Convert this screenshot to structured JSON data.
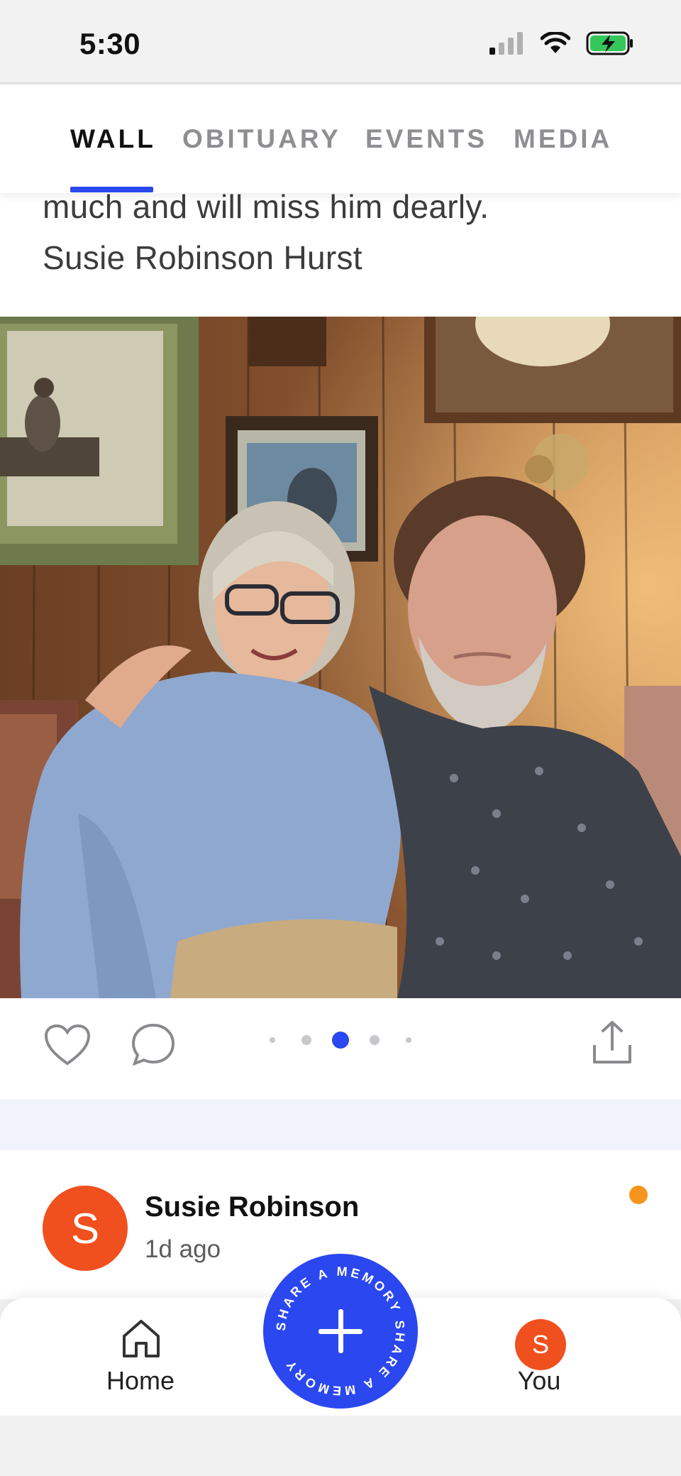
{
  "status_bar": {
    "time": "5:30",
    "icons": [
      "cellular-signal-icon",
      "wifi-icon",
      "battery-charging-icon"
    ]
  },
  "tabs": [
    {
      "label": "WALL",
      "active": true
    },
    {
      "label": "OBITUARY",
      "active": false
    },
    {
      "label": "EVENTS",
      "active": false
    },
    {
      "label": "MEDIA",
      "active": false
    }
  ],
  "post": {
    "text_lines": [
      "much and will miss him dearly.",
      "Susie Robinson Hurst"
    ],
    "carousel": {
      "total": 5,
      "active_index": 2
    }
  },
  "actions": {
    "icons": [
      "heart-icon",
      "comment-icon",
      "share-upload-icon"
    ]
  },
  "next_post": {
    "avatar_initial": "S",
    "author": "Susie Robinson",
    "time_ago": "1d ago",
    "unread": true
  },
  "bottom_nav": {
    "home_label": "Home",
    "you_label": "You",
    "you_initial": "S",
    "fab_ring_text": "SHARE A MEMORY SHARE A MEMORY"
  },
  "colors": {
    "accent": "#2b47ef",
    "avatar": "#f0501e",
    "unread": "#f7941d"
  }
}
